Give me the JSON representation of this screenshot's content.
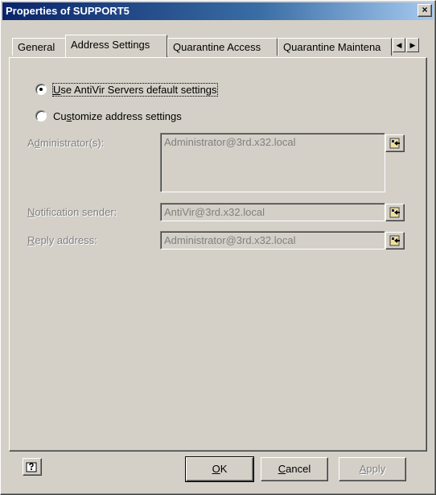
{
  "window": {
    "title": "Properties of SUPPORT5",
    "close_label": "×"
  },
  "tabs": [
    {
      "label": "General"
    },
    {
      "label": "Address Settings"
    },
    {
      "label": "Quarantine Access"
    },
    {
      "label": "Quarantine Maintena"
    }
  ],
  "tab_scroll": {
    "left": "◀",
    "right": "▶"
  },
  "options": {
    "use_default": {
      "prefix": "",
      "accel": "U",
      "rest": "se AntiVir Servers default settings"
    },
    "customize": {
      "prefix": "Cu",
      "accel": "s",
      "rest": "tomize address settings"
    }
  },
  "fields": {
    "administrator": {
      "prefix": "A",
      "accel": "d",
      "rest": "ministrator(s):",
      "value": "Administrator@3rd.x32.local"
    },
    "notification_sender": {
      "prefix": "",
      "accel": "N",
      "rest": "otification sender:",
      "value": "AntiVir@3rd.x32.local"
    },
    "reply_address": {
      "prefix": "",
      "accel": "R",
      "rest": "eply address:",
      "value": "Administrator@3rd.x32.local"
    }
  },
  "buttons": {
    "ok": {
      "accel": "O",
      "rest": "K"
    },
    "cancel": {
      "accel": "C",
      "rest": "ancel"
    },
    "apply": {
      "accel": "A",
      "rest": "pply"
    }
  },
  "icons": {
    "browse": "address-book-icon",
    "help": "help-icon"
  }
}
